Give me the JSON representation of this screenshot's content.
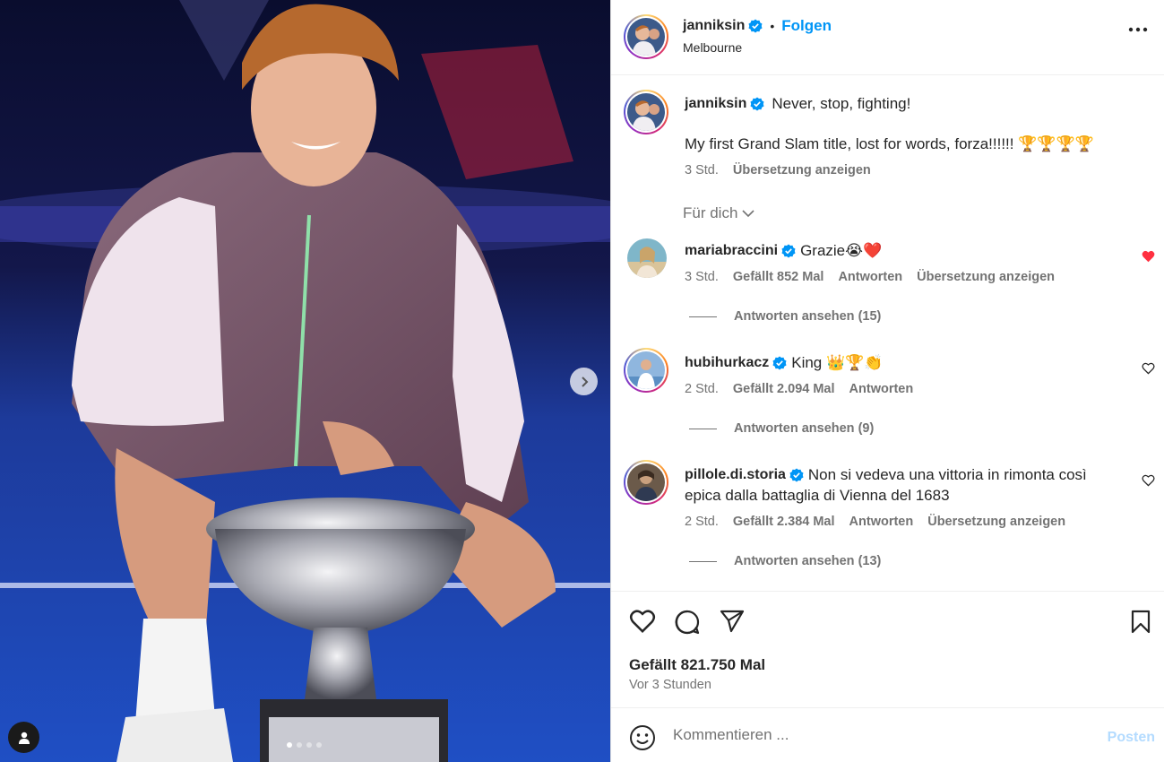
{
  "post": {
    "username": "janniksin",
    "follow_label": "Folgen",
    "location": "Melbourne",
    "caption_title": "Never, stop, fighting!",
    "caption_body": "My first Grand Slam title, lost for words, forza!!!!!! 🏆🏆🏆🏆",
    "caption_time": "3 Std.",
    "translate_label": "Übersetzung anzeigen",
    "for_you_label": "Für dich",
    "likes": "Gefällt 821.750 Mal",
    "time_ago": "Vor 3 Stunden",
    "media_slide": {
      "current": 1,
      "total": 4
    }
  },
  "comments": [
    {
      "username": "mariabraccini",
      "text": "Grazie😭❤️",
      "time": "3 Std.",
      "likes": "Gefällt 852 Mal",
      "reply_label": "Antworten",
      "translate_label": "Übersetzung anzeigen",
      "view_replies": "Antworten ansehen (15)",
      "liked": true
    },
    {
      "username": "hubihurkacz",
      "text": "King 👑🏆👏",
      "time": "2 Std.",
      "likes": "Gefällt 2.094 Mal",
      "reply_label": "Antworten",
      "view_replies": "Antworten ansehen (9)",
      "liked": false
    },
    {
      "username": "pillole.di.storia",
      "text_line1": "Non si vedeva una vittoria in rimonta così",
      "text_line2": "epica dalla battaglia di Vienna del 1683",
      "time": "2 Std.",
      "likes": "Gefällt 2.384 Mal",
      "reply_label": "Antworten",
      "translate_label": "Übersetzung anzeigen",
      "view_replies": "Antworten ansehen (13)",
      "liked": false
    }
  ],
  "comment_box": {
    "placeholder": "Kommentieren ...",
    "post_label": "Posten"
  },
  "colors": {
    "accent": "#0095f6",
    "liked": "#ff3040",
    "verified": "#0095f6",
    "muted": "#737373"
  }
}
